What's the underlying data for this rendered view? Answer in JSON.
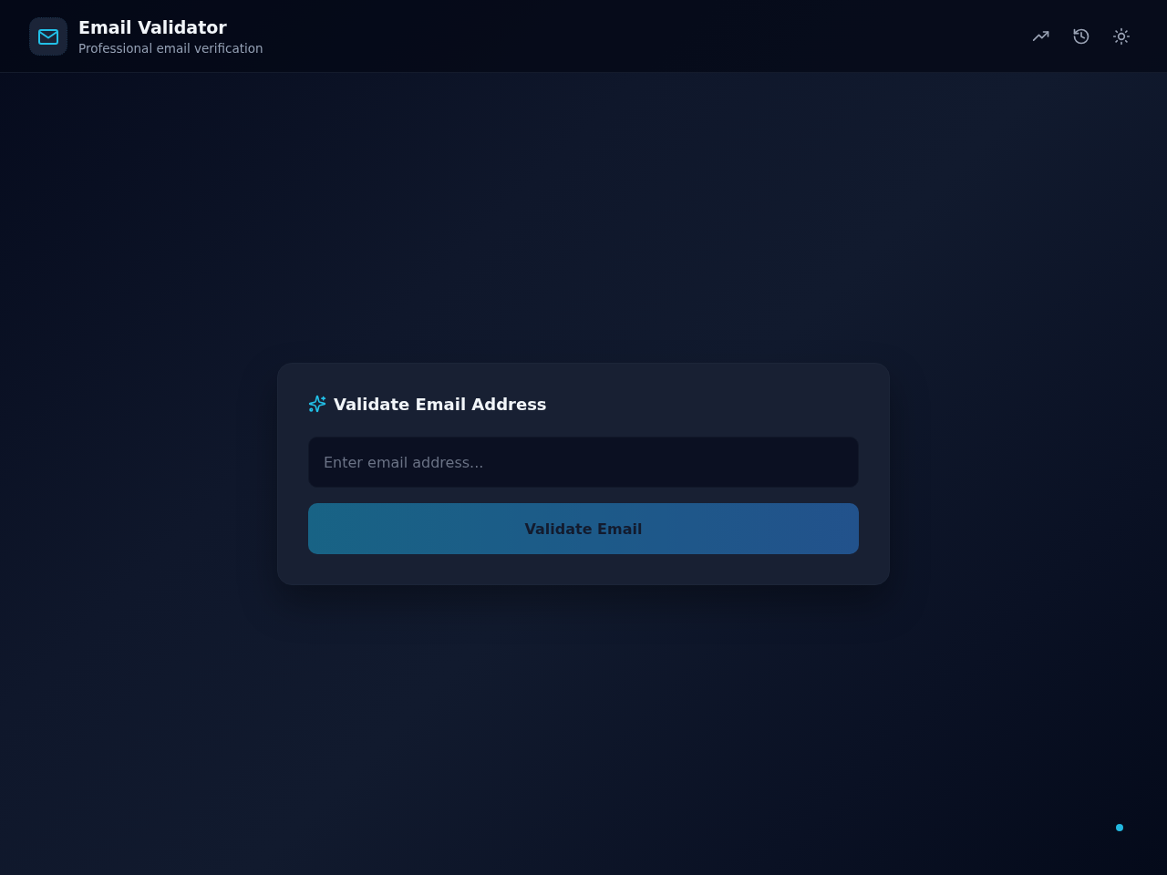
{
  "header": {
    "title": "Email Validator",
    "subtitle": "Professional email verification"
  },
  "card": {
    "title": "Validate Email Address",
    "input": {
      "placeholder": "Enter email address..."
    },
    "button": {
      "label": "Validate Email",
      "disabled": true
    }
  }
}
